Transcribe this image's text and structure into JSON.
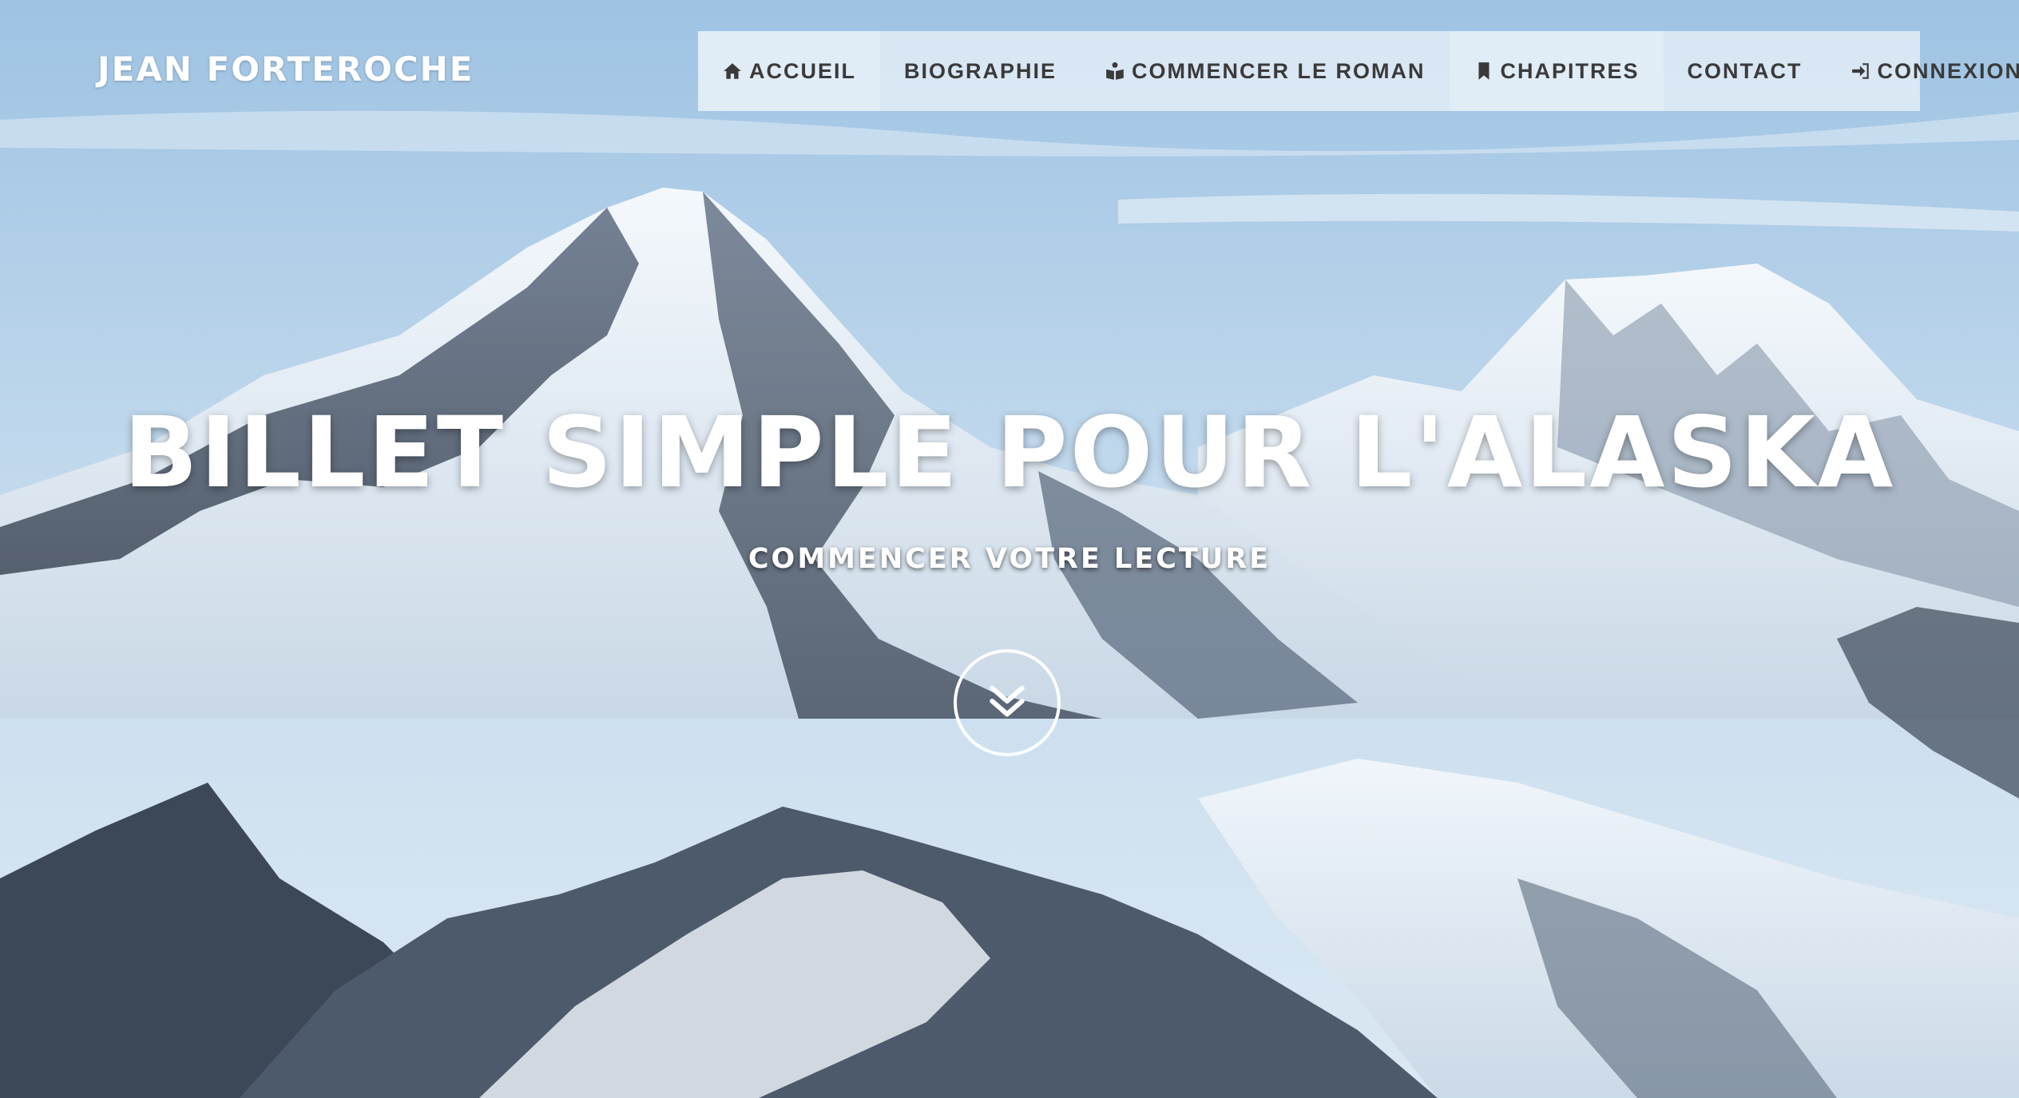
{
  "brand": {
    "name": "JEAN FORTEROCHE"
  },
  "nav": {
    "items": [
      {
        "label": "ACCUEIL",
        "icon": "home-icon",
        "active": true
      },
      {
        "label": "BIOGRAPHIE",
        "icon": "",
        "active": false
      },
      {
        "label": "COMMENCER LE ROMAN",
        "icon": "book-reader-icon",
        "active": false
      },
      {
        "label": "CHAPITRES",
        "icon": "bookmark-icon",
        "active": true
      },
      {
        "label": "CONTACT",
        "icon": "",
        "active": false
      },
      {
        "label": "CONNEXION",
        "icon": "sign-in-icon",
        "active": false
      }
    ]
  },
  "hero": {
    "title": "BILLET SIMPLE POUR L'ALASKA",
    "subtitle": "COMMENCER VOTRE LECTURE",
    "scroll_icon": "double-chevron-down-icon",
    "background": "snowy-mountains-photo"
  },
  "colors": {
    "nav_text": "#3a3a3a",
    "hero_text": "#ffffff"
  }
}
